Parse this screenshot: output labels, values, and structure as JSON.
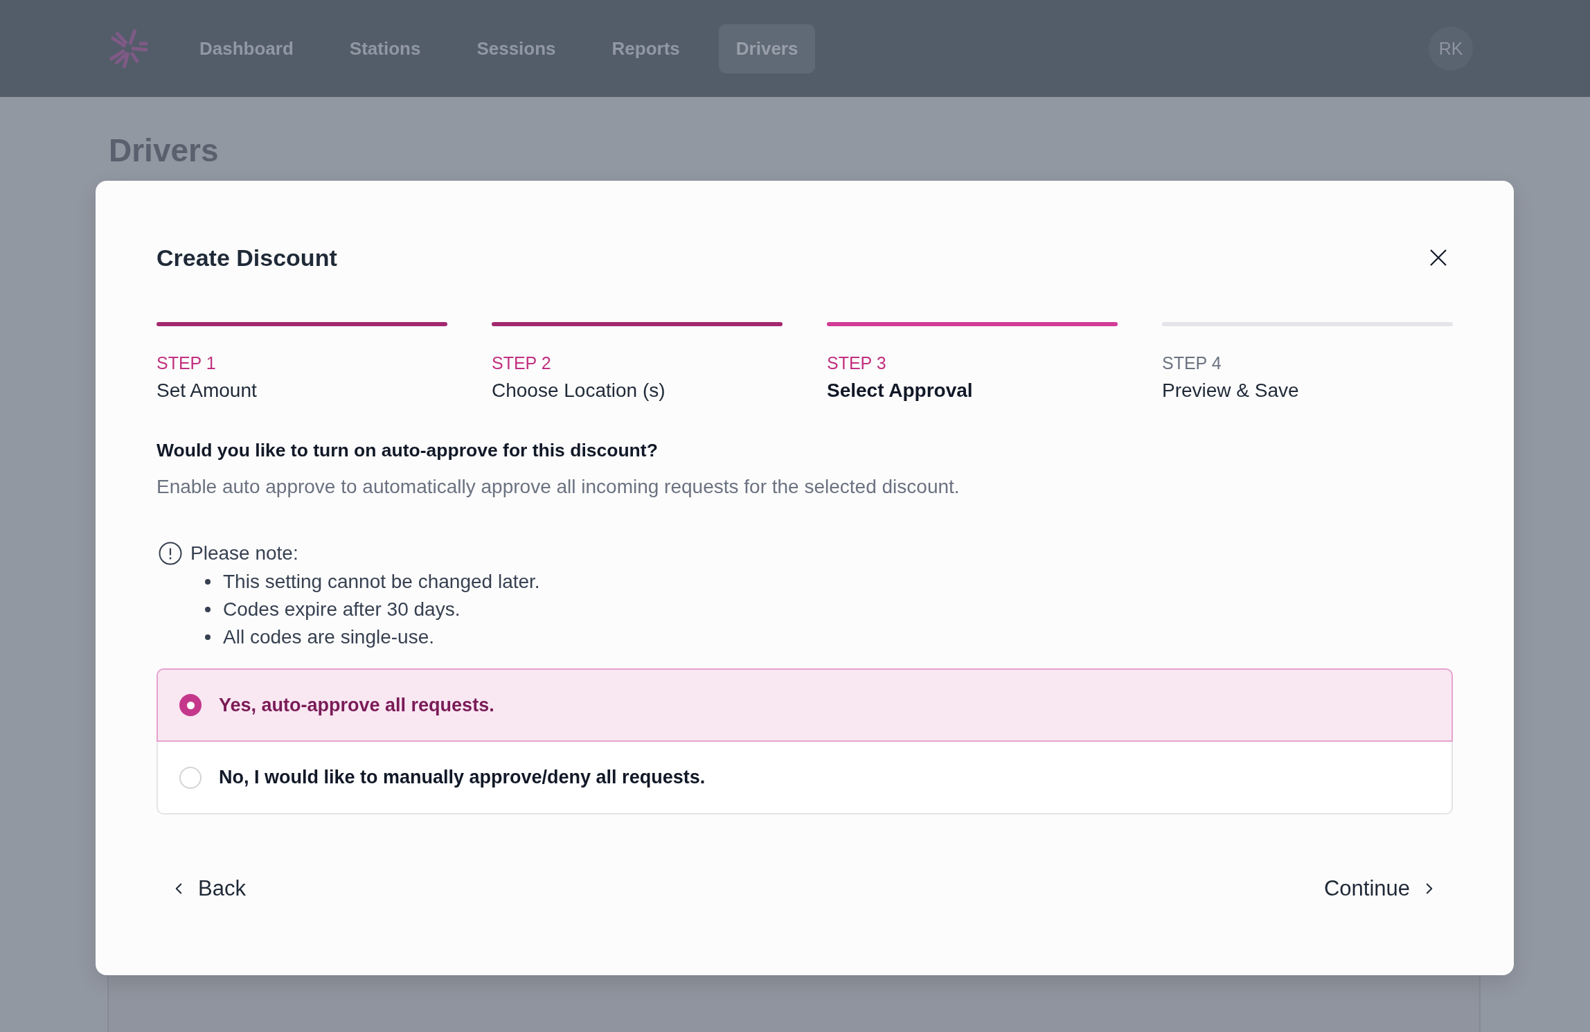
{
  "nav": {
    "items": [
      {
        "label": "Dashboard",
        "selected": false
      },
      {
        "label": "Stations",
        "selected": false
      },
      {
        "label": "Sessions",
        "selected": false
      },
      {
        "label": "Reports",
        "selected": false
      },
      {
        "label": "Drivers",
        "selected": true
      }
    ],
    "avatar": "RK"
  },
  "page_title": "Drivers",
  "dialog": {
    "title": "Create Discount",
    "steps": [
      {
        "label": "STEP 1",
        "title": "Set Amount",
        "completed": true,
        "selected": false
      },
      {
        "label": "STEP 2",
        "title": "Choose Location (s)",
        "completed": true,
        "selected": false
      },
      {
        "label": "STEP 3",
        "title": "Select Approval",
        "completed": false,
        "selected": true
      },
      {
        "label": "STEP 4",
        "title": "Preview & Save",
        "completed": false,
        "selected": false
      }
    ],
    "question": "Would you like to turn on auto-approve for this discount?",
    "description": "Enable auto approve to automatically approve all incoming requests for the selected discount.",
    "note": {
      "label": "Please note:",
      "items": [
        "This setting cannot be changed later.",
        "Codes expire after 30 days.",
        "All codes are single-use."
      ]
    },
    "options": [
      {
        "label": "Yes, auto-approve all requests.",
        "selected": true
      },
      {
        "label": "No, I would like to manually approve/deny all requests.",
        "selected": false
      }
    ],
    "back": "Back",
    "continue": "Continue"
  }
}
